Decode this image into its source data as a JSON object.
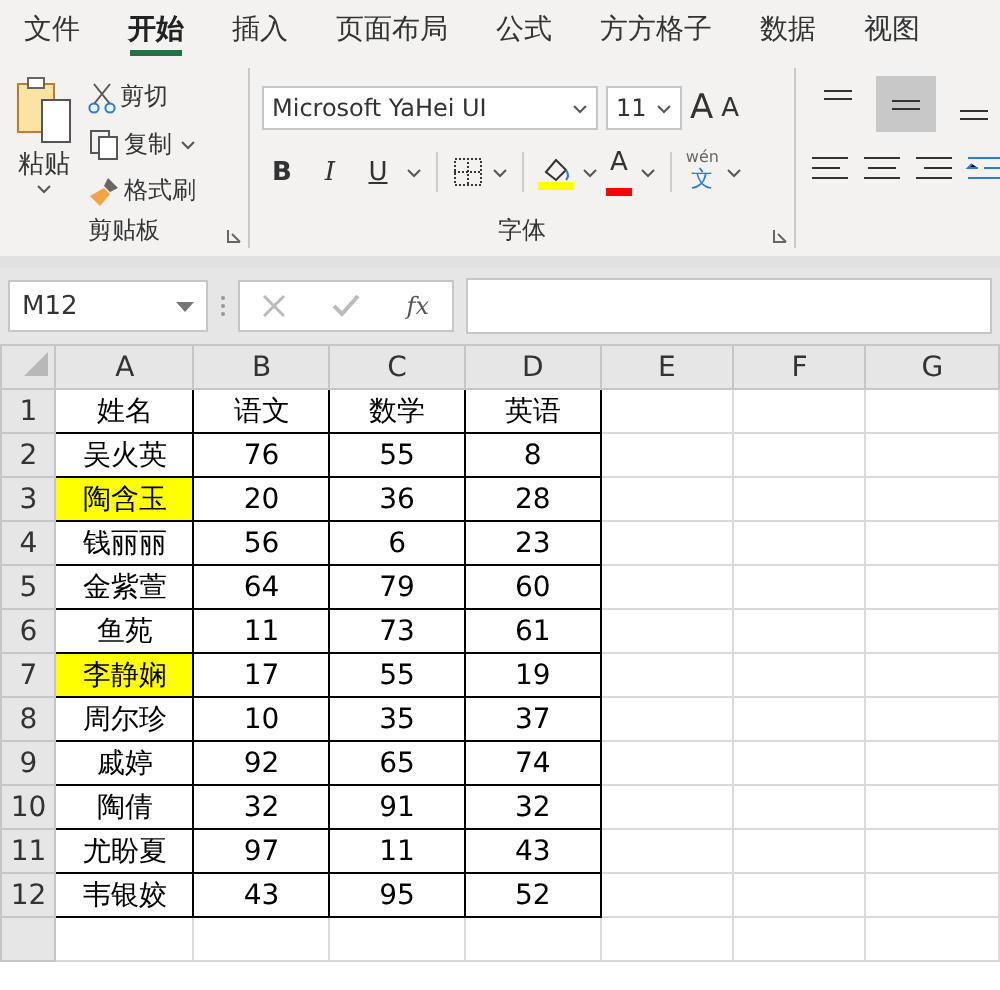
{
  "tabs": [
    {
      "label": "文件",
      "selected": false
    },
    {
      "label": "开始",
      "selected": true
    },
    {
      "label": "插入",
      "selected": false
    },
    {
      "label": "页面布局",
      "selected": false
    },
    {
      "label": "公式",
      "selected": false
    },
    {
      "label": "方方格子",
      "selected": false
    },
    {
      "label": "数据",
      "selected": false
    },
    {
      "label": "视图",
      "selected": false
    }
  ],
  "clipboard": {
    "paste": "粘贴",
    "cut": "剪切",
    "copy": "复制",
    "painter": "格式刷",
    "group": "剪贴板"
  },
  "font": {
    "name": "Microsoft YaHei UI",
    "size": "11",
    "grow": "A",
    "shrink": "A",
    "bold": "B",
    "italic": "I",
    "underline": "U",
    "color_letter": "A",
    "phonetic_top": "wén",
    "phonetic_bottom": "文",
    "group": "字体"
  },
  "alignment": {
    "buttons": [
      {
        "kind": "top",
        "selected": false
      },
      {
        "kind": "middle",
        "selected": true
      },
      {
        "kind": "bottom",
        "selected": false
      }
    ]
  },
  "formula_bar": {
    "name_box": "M12",
    "fx": "fx"
  },
  "columns": [
    "A",
    "B",
    "C",
    "D",
    "E",
    "F",
    "G"
  ],
  "rows": [
    {
      "number": "1",
      "cells": [
        "姓名",
        "语文",
        "数学",
        "英语"
      ],
      "highlighted": false
    },
    {
      "number": "2",
      "cells": [
        "吴火英",
        "76",
        "55",
        "8"
      ],
      "highlighted": false
    },
    {
      "number": "3",
      "cells": [
        "陶含玉",
        "20",
        "36",
        "28"
      ],
      "highlighted": true
    },
    {
      "number": "4",
      "cells": [
        "钱丽丽",
        "56",
        "6",
        "23"
      ],
      "highlighted": false
    },
    {
      "number": "5",
      "cells": [
        "金紫萱",
        "64",
        "79",
        "60"
      ],
      "highlighted": false
    },
    {
      "number": "6",
      "cells": [
        "鱼苑",
        "11",
        "73",
        "61"
      ],
      "highlighted": false
    },
    {
      "number": "7",
      "cells": [
        "李静娴",
        "17",
        "55",
        "19"
      ],
      "highlighted": true
    },
    {
      "number": "8",
      "cells": [
        "周尔珍",
        "10",
        "35",
        "37"
      ],
      "highlighted": false
    },
    {
      "number": "9",
      "cells": [
        "戚婷",
        "92",
        "65",
        "74"
      ],
      "highlighted": false
    },
    {
      "number": "10",
      "cells": [
        "陶倩",
        "32",
        "91",
        "32"
      ],
      "highlighted": false
    },
    {
      "number": "11",
      "cells": [
        "尤盼夏",
        "97",
        "11",
        "43"
      ],
      "highlighted": false
    },
    {
      "number": "12",
      "cells": [
        "韦银姣",
        "43",
        "95",
        "52"
      ],
      "highlighted": false
    }
  ]
}
